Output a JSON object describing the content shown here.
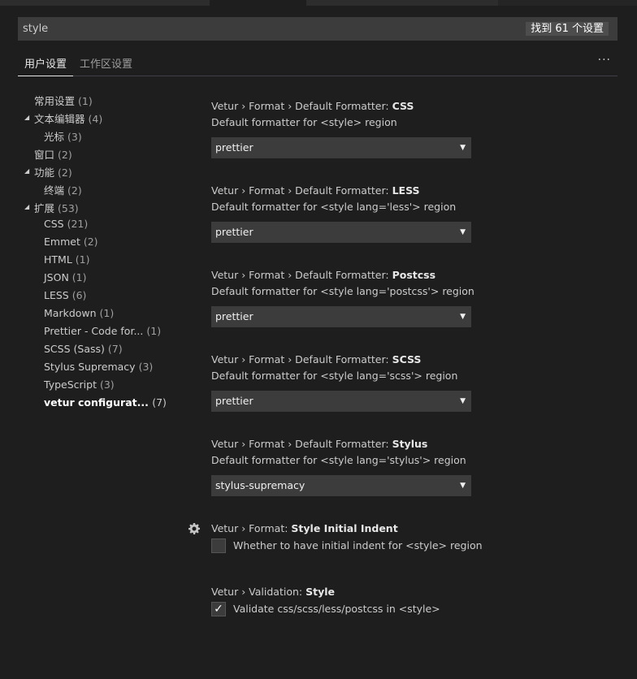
{
  "search": {
    "value": "style",
    "result_count": "找到 61 个设置"
  },
  "tabs": [
    {
      "label": "用户设置",
      "active": true
    },
    {
      "label": "工作区设置",
      "active": false
    }
  ],
  "more_label": "···",
  "toc": [
    {
      "label": "常用设置",
      "count": "(1)"
    },
    {
      "label": "文本编辑器",
      "count": "(4)"
    },
    {
      "label": "光标",
      "count": "(3)"
    },
    {
      "label": "窗口",
      "count": "(2)"
    },
    {
      "label": "功能",
      "count": "(2)"
    },
    {
      "label": "终端",
      "count": "(2)"
    },
    {
      "label": "扩展",
      "count": "(53)"
    },
    {
      "label": "CSS",
      "count": "(21)"
    },
    {
      "label": "Emmet",
      "count": "(2)"
    },
    {
      "label": "HTML",
      "count": "(1)"
    },
    {
      "label": "JSON",
      "count": "(1)"
    },
    {
      "label": "LESS",
      "count": "(6)"
    },
    {
      "label": "Markdown",
      "count": "(1)"
    },
    {
      "label": "Prettier - Code for...",
      "count": "(1)"
    },
    {
      "label": "SCSS (Sass)",
      "count": "(7)"
    },
    {
      "label": "Stylus Supremacy",
      "count": "(3)"
    },
    {
      "label": "TypeScript",
      "count": "(3)"
    },
    {
      "label": "vetur configurat...",
      "count": "(7)"
    }
  ],
  "settings": [
    {
      "prefix": "Vetur › Format › Default Formatter: ",
      "name": "CSS",
      "desc": "Default formatter for <style> region",
      "value": "prettier"
    },
    {
      "prefix": "Vetur › Format › Default Formatter: ",
      "name": "LESS",
      "desc": "Default formatter for <style lang='less'> region",
      "value": "prettier"
    },
    {
      "prefix": "Vetur › Format › Default Formatter: ",
      "name": "Postcss",
      "desc": "Default formatter for <style lang='postcss'> region",
      "value": "prettier"
    },
    {
      "prefix": "Vetur › Format › Default Formatter: ",
      "name": "SCSS",
      "desc": "Default formatter for <style lang='scss'> region",
      "value": "prettier"
    },
    {
      "prefix": "Vetur › Format › Default Formatter: ",
      "name": "Stylus",
      "desc": "Default formatter for <style lang='stylus'> region",
      "value": "stylus-supremacy"
    }
  ],
  "indent_setting": {
    "prefix": "Vetur › Format: ",
    "name": "Style Initial Indent",
    "label": "Whether to have initial indent for <style> region",
    "checked": false
  },
  "validation_setting": {
    "prefix": "Vetur › Validation: ",
    "name": "Style",
    "label": "Validate css/scss/less/postcss in <style>",
    "checked": true,
    "check_glyph": "✓"
  },
  "colors": {
    "background": "#1e1e1e",
    "input_background": "#3c3c3c",
    "text": "#cccccc"
  }
}
